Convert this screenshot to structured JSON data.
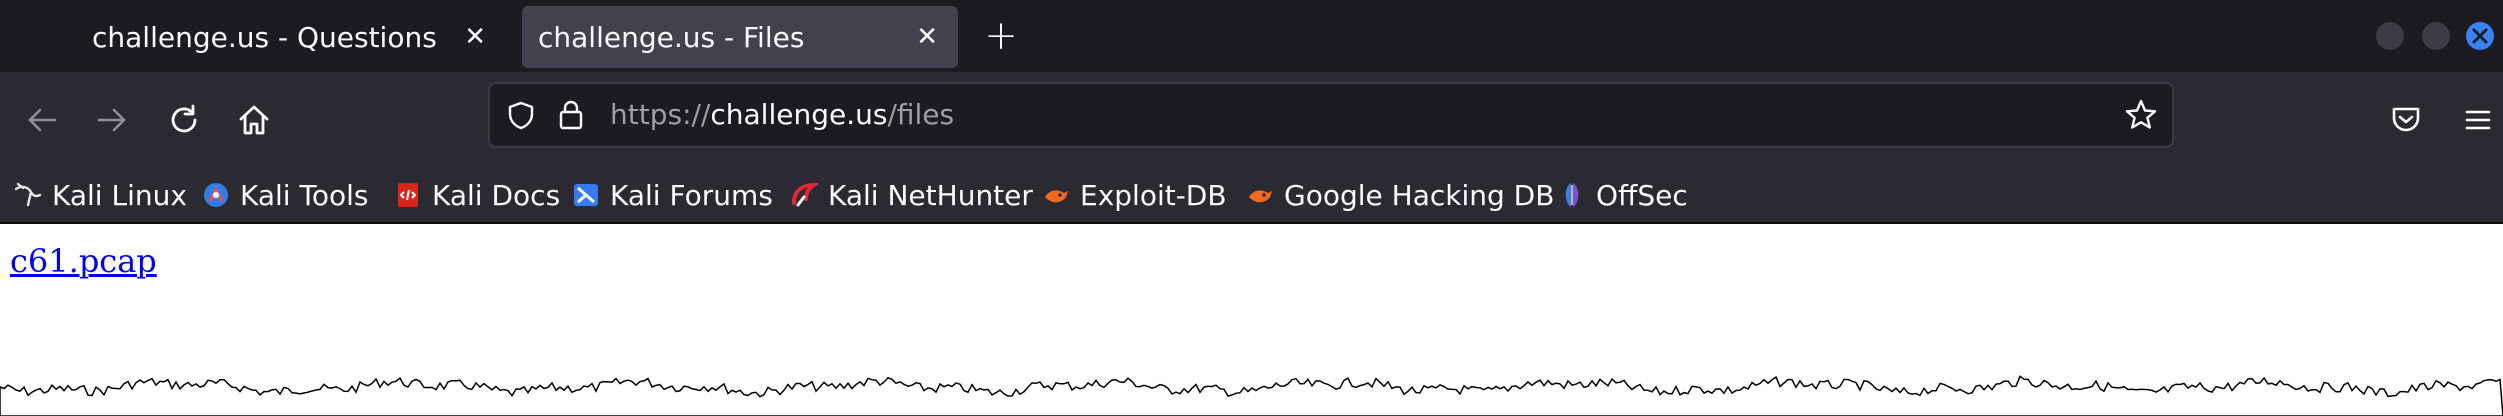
{
  "tabs": [
    {
      "title": "challenge.us - Questions",
      "active": false
    },
    {
      "title": "challenge.us - Files",
      "active": true
    }
  ],
  "tab_close_glyph": "✕",
  "new_tab_glyph": "+",
  "url": {
    "scheme": "https://",
    "host": "challenge.us",
    "path": "/files"
  },
  "bookmarks": [
    {
      "label": "Kali Linux",
      "icon": "kali-dragon-icon"
    },
    {
      "label": "Kali Tools",
      "icon": "kali-tools-icon"
    },
    {
      "label": "Kali Docs",
      "icon": "kali-docs-icon"
    },
    {
      "label": "Kali Forums",
      "icon": "kali-forums-icon"
    },
    {
      "label": "Kali NetHunter",
      "icon": "kali-nethunter-icon"
    },
    {
      "label": "Exploit-DB",
      "icon": "exploit-db-icon"
    },
    {
      "label": "Google Hacking DB",
      "icon": "ghdb-icon"
    },
    {
      "label": "OffSec",
      "icon": "offsec-icon"
    }
  ],
  "content": {
    "link": "c61.pcap"
  },
  "colors": {
    "accent": "#3b82f6",
    "link": "#0000ee",
    "toolbar": "#2b2a33",
    "tabstrip": "#1c1b22"
  }
}
